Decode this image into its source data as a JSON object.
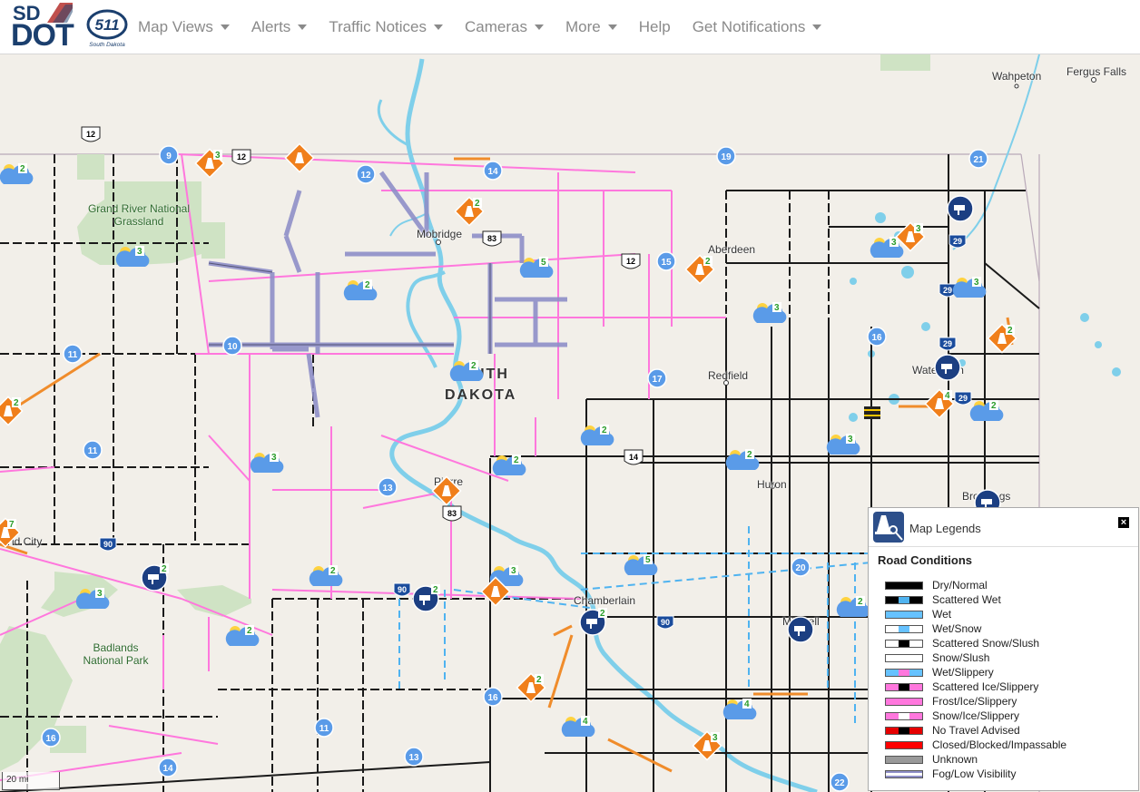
{
  "header": {
    "logo_sd": "SD",
    "logo_dot": "DOT",
    "logo_511": "511",
    "logo_511_sub": "South Dakota",
    "nav": [
      {
        "label": "Map Views",
        "dropdown": true
      },
      {
        "label": "Alerts",
        "dropdown": true
      },
      {
        "label": "Traffic Notices",
        "dropdown": true
      },
      {
        "label": "Cameras",
        "dropdown": true
      },
      {
        "label": "More",
        "dropdown": true
      },
      {
        "label": "Help",
        "dropdown": false
      },
      {
        "label": "Get Notifications",
        "dropdown": true
      }
    ]
  },
  "map": {
    "state_label_1": "UTH",
    "state_label_2": "DAKOTA",
    "places": {
      "fergus_falls": "Fergus Falls",
      "wahpeton": "Wahpeton",
      "mobridge": "Mobridge",
      "aberdeen": "Aberdeen",
      "redfield": "Redfield",
      "watertown": "Watertown",
      "huron": "Huron",
      "pierre": "Pierre",
      "brookings": "Brookings",
      "rapid_city": "id City",
      "chamberlain": "Chamberlain",
      "mitchell": "Mitchell"
    },
    "parks": {
      "grand_river": "Grand River National Grassland",
      "badlands": "Badlands National Park"
    },
    "shields": [
      "12",
      "12",
      "83",
      "12",
      "14",
      "83",
      "90",
      "90",
      "90",
      "29",
      "29",
      "29",
      "29"
    ],
    "scale": "20 mi"
  },
  "legend": {
    "title": "Map Legends",
    "close": "×",
    "section": "Road Conditions",
    "items": [
      {
        "label": "Dry/Normal",
        "color": "#000000"
      },
      {
        "label": "Scattered Wet",
        "color": "#4fb3f0"
      },
      {
        "label": "Wet",
        "color": "#66c2ff"
      },
      {
        "label": "Wet/Snow",
        "color": "#66c2ff"
      },
      {
        "label": "Scattered Snow/Slush",
        "color": "#000000"
      },
      {
        "label": "Snow/Slush",
        "color": "#ffffff"
      },
      {
        "label": "Wet/Slippery",
        "color": "#66c2ff"
      },
      {
        "label": "Scattered Ice/Slippery",
        "color": "#ff66cc"
      },
      {
        "label": "Frost/Ice/Slippery",
        "color": "#ff77dd"
      },
      {
        "label": "Snow/Ice/Slippery",
        "color": "#ff77dd"
      },
      {
        "label": "No Travel Advised",
        "color": "#e60000"
      },
      {
        "label": "Closed/Blocked/Impassable",
        "color": "#ff0000"
      },
      {
        "label": "Unknown",
        "color": "#999999"
      },
      {
        "label": "Fog/Low Visibility",
        "color": "#8f8fc8"
      }
    ]
  },
  "markers": {
    "weather": [
      "2",
      "3",
      "2",
      "3",
      "5",
      "2",
      "3",
      "3",
      "2",
      "2",
      "2",
      "3",
      "2",
      "3",
      "2",
      "3",
      "2",
      "5",
      "3",
      "2",
      "4",
      "4",
      "2",
      "2",
      "7"
    ],
    "cameras": [
      "9",
      "12",
      "14",
      "19",
      "21",
      "15",
      "10",
      "11",
      "16",
      "17",
      "11",
      "13",
      "20",
      "16",
      "11",
      "16",
      "14",
      "13",
      "22"
    ],
    "construction": [
      "3",
      "2",
      "2",
      "3",
      "2",
      "4",
      "2",
      "2",
      "2",
      "3",
      "7"
    ],
    "camera_groups": [
      "2",
      "2",
      "2"
    ]
  }
}
